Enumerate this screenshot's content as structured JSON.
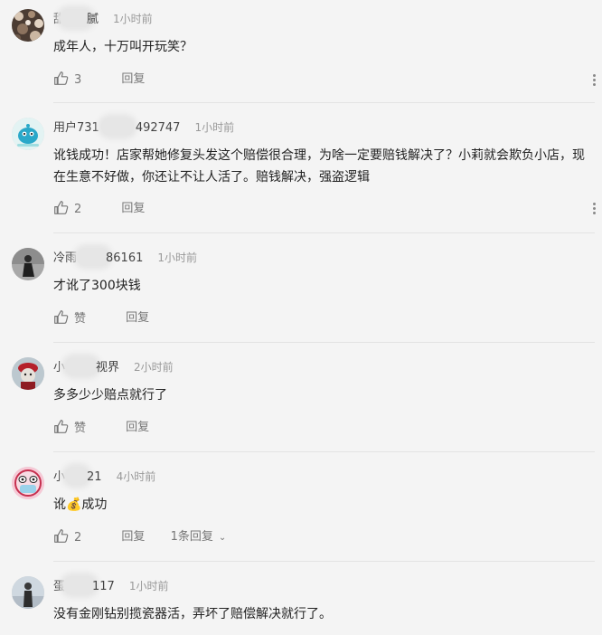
{
  "comments": [
    {
      "username_prefix": "甜",
      "username_suffix": "腻",
      "time": "1小时前",
      "text": "成年人，十万叫开玩笑？",
      "like_label": "3",
      "reply_label": "回复",
      "avatar": {
        "icon": "floral-avatar",
        "bg": "#5a4a3f"
      }
    },
    {
      "username_prefix": "用户731",
      "username_suffix": "492747",
      "time": "1小时前",
      "text": "讹钱成功！店家帮她修复头发这个赔偿很合理，为啥一定要赔钱解决了？小莉就会欺负小店，现在生意不好做，你还让不让人活了。赔钱解决，强盗逻辑",
      "like_label": "2",
      "reply_label": "回复",
      "avatar": {
        "icon": "cartoon-cyan-avatar",
        "bg": "#dff3f5"
      }
    },
    {
      "username_prefix": "冷雨",
      "username_suffix": "86161",
      "time": "1小时前",
      "text": "才讹了300块钱",
      "like_label": "赞",
      "reply_label": "回复",
      "avatar": {
        "icon": "dark-figure-avatar",
        "bg": "#9a9a9a"
      }
    },
    {
      "username_prefix": "小",
      "username_suffix": "视界",
      "time": "2小时前",
      "text": "多多少少赔点就行了",
      "like_label": "赞",
      "reply_label": "回复",
      "avatar": {
        "icon": "red-hat-toy-avatar",
        "bg": "#b9c6cc"
      }
    },
    {
      "username_prefix": "小",
      "username_suffix": "21",
      "time": "4小时前",
      "text": "讹💰成功",
      "like_label": "2",
      "reply_label": "回复",
      "replies_label": "1条回复",
      "avatar": {
        "icon": "masked-face-avatar",
        "bg": "#f4c5d3"
      }
    },
    {
      "username_prefix": "蛋",
      "username_suffix": "117",
      "time": "1小时前",
      "text": "没有金刚钻别揽瓷器活，弄坏了赔偿解决就行了。",
      "avatar": {
        "icon": "figure-photo-avatar",
        "bg": "#c9d3dc"
      }
    }
  ]
}
